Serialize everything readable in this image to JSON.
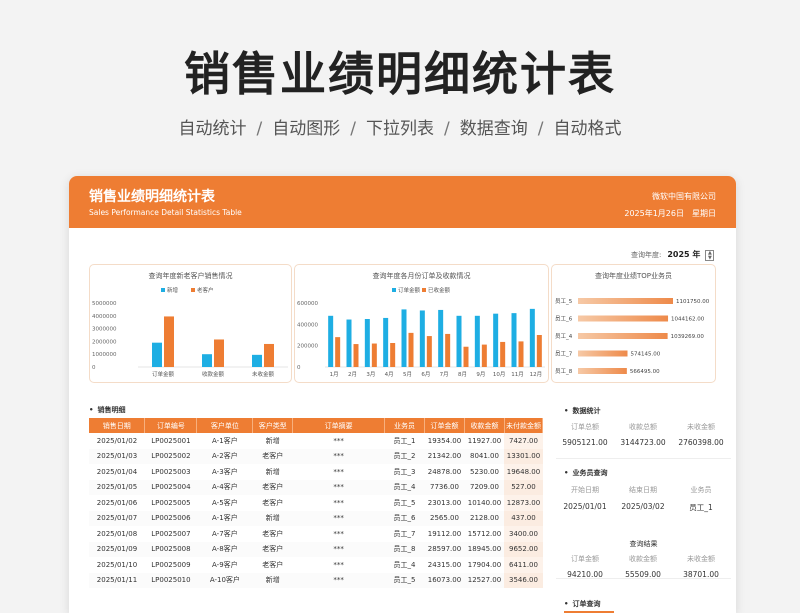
{
  "hero": {
    "title": "销售业绩明细统计表",
    "features": [
      "自动统计",
      "自动图形",
      "下拉列表",
      "数据查询",
      "自动格式"
    ]
  },
  "header": {
    "title": "销售业绩明细统计表",
    "subtitle": "Sales Performance Detail Statistics Table",
    "company": "微软中国有限公司",
    "date": "2025年1月26日",
    "weekday": "星期日"
  },
  "year_selector": {
    "label": "查询年度:",
    "value": "2025 年"
  },
  "colors": {
    "accent": "#ee7d33",
    "blue": "#1eaee3"
  },
  "chart_data": [
    {
      "type": "bar",
      "title": "查询年度新老客户销售情况",
      "categories": [
        "订单金额",
        "收款金额",
        "未收金额"
      ],
      "series": [
        {
          "name": "新增",
          "values": [
            1900000,
            1000000,
            950000
          ]
        },
        {
          "name": "老客户",
          "values": [
            3950000,
            2150000,
            1800000
          ]
        }
      ],
      "yticks": [
        "5000000",
        "4000000",
        "3000000",
        "2000000",
        "1000000",
        "0"
      ],
      "ylim": [
        0,
        5000000
      ]
    },
    {
      "type": "bar",
      "title": "查询年度各月份订单及收款情况",
      "categories": [
        "1月",
        "2月",
        "3月",
        "4月",
        "5月",
        "6月",
        "7月",
        "8月",
        "9月",
        "10月",
        "11月",
        "12月"
      ],
      "series": [
        {
          "name": "订单金额",
          "values": [
            480000,
            445000,
            450000,
            460000,
            540000,
            530000,
            535000,
            480000,
            480000,
            500000,
            505000,
            545000
          ]
        },
        {
          "name": "已收金额",
          "values": [
            280000,
            215000,
            220000,
            225000,
            320000,
            290000,
            310000,
            190000,
            210000,
            235000,
            240000,
            300000
          ]
        }
      ],
      "yticks": [
        "600000",
        "400000",
        "200000",
        "0"
      ],
      "ylim": [
        0,
        600000
      ]
    },
    {
      "type": "bar",
      "orientation": "horizontal",
      "title": "查询年度业绩TOP业务员",
      "categories": [
        "员工_5",
        "员工_6",
        "员工_4",
        "员工_7",
        "员工_8"
      ],
      "values": [
        1101750.0,
        1044162.0,
        1039269.0,
        574145.0,
        566495.0
      ],
      "labels": [
        "1101750.00",
        "1044162.00",
        "1039269.00",
        "574145.00",
        "566495.00"
      ]
    }
  ],
  "sales_detail": {
    "title": "销售明细",
    "columns": [
      "销售日期",
      "订单编号",
      "客户单位",
      "客户类型",
      "订单摘要",
      "业务员",
      "订单金额",
      "收款金额",
      "未付款金额"
    ],
    "rows": [
      [
        "2025/01/02",
        "LP0025001",
        "A-1客户",
        "新增",
        "***",
        "员工_1",
        "19354.00",
        "11927.00",
        "7427.00"
      ],
      [
        "2025/01/03",
        "LP0025002",
        "A-2客户",
        "老客户",
        "***",
        "员工_2",
        "21342.00",
        "8041.00",
        "13301.00"
      ],
      [
        "2025/01/04",
        "LP0025003",
        "A-3客户",
        "新增",
        "***",
        "员工_3",
        "24878.00",
        "5230.00",
        "19648.00"
      ],
      [
        "2025/01/05",
        "LP0025004",
        "A-4客户",
        "老客户",
        "***",
        "员工_4",
        "7736.00",
        "7209.00",
        "527.00"
      ],
      [
        "2025/01/06",
        "LP0025005",
        "A-5客户",
        "老客户",
        "***",
        "员工_5",
        "23013.00",
        "10140.00",
        "12873.00"
      ],
      [
        "2025/01/07",
        "LP0025006",
        "A-1客户",
        "新增",
        "***",
        "员工_6",
        "2565.00",
        "2128.00",
        "437.00"
      ],
      [
        "2025/01/08",
        "LP0025007",
        "A-7客户",
        "老客户",
        "***",
        "员工_7",
        "19112.00",
        "15712.00",
        "3400.00"
      ],
      [
        "2025/01/09",
        "LP0025008",
        "A-8客户",
        "老客户",
        "***",
        "员工_8",
        "28597.00",
        "18945.00",
        "9652.00"
      ],
      [
        "2025/01/10",
        "LP0025009",
        "A-9客户",
        "老客户",
        "***",
        "员工_4",
        "24315.00",
        "17904.00",
        "6411.00"
      ],
      [
        "2025/01/11",
        "LP0025010",
        "A-10客户",
        "新增",
        "***",
        "员工_5",
        "16073.00",
        "12527.00",
        "3546.00"
      ]
    ]
  },
  "data_stats": {
    "title": "数据统计",
    "labels": [
      "订单总额",
      "收款总额",
      "未收金额"
    ],
    "values": [
      "5905121.00",
      "3144723.00",
      "2760398.00"
    ]
  },
  "salesperson_query": {
    "title": "业务员查询",
    "labels": [
      "开始日期",
      "结束日期",
      "业务员"
    ],
    "values": [
      "2025/01/01",
      "2025/03/02",
      "员工_1"
    ],
    "result_title": "查询结果",
    "result_labels": [
      "订单金额",
      "收款金额",
      "未收金额"
    ],
    "result_values": [
      "94210.00",
      "55509.00",
      "38701.00"
    ]
  },
  "order_query": {
    "title": "订单查询"
  }
}
